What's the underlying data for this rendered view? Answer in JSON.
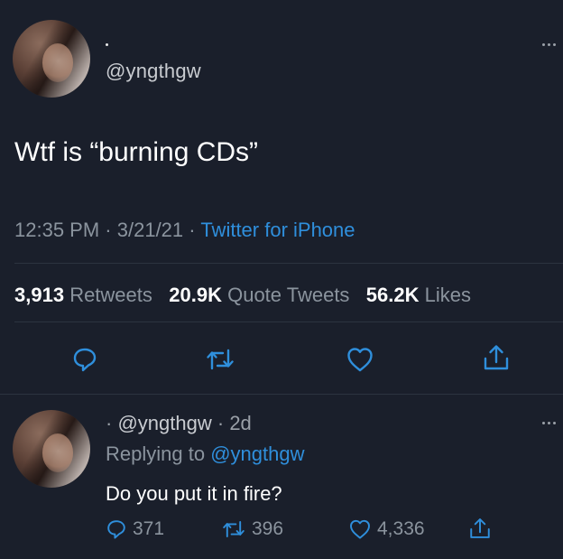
{
  "tweet": {
    "display_name": "·",
    "handle": "@yngthgw",
    "text": "Wtf is “burning CDs”",
    "time": "12:35 PM",
    "date": "3/21/21",
    "separator": "·",
    "source": "Twitter for iPhone",
    "stats": {
      "retweets_count": "3,913",
      "retweets_label": "Retweets",
      "quotes_count": "20.9K",
      "quotes_label": "Quote Tweets",
      "likes_count": "56.2K",
      "likes_label": "Likes"
    }
  },
  "reply": {
    "display_name": "·",
    "handle": "@yngthgw",
    "age": "2d",
    "separator": "·",
    "replying_prefix": "Replying to",
    "replying_to": "@yngthgw",
    "text": "Do you put it in fire?",
    "actions": {
      "replies": "371",
      "retweets": "396",
      "likes": "4,336"
    }
  },
  "colors": {
    "background": "#1a1f2b",
    "link": "#2f8fdc",
    "muted": "#8b949e",
    "icon": "#2f8fdc"
  }
}
